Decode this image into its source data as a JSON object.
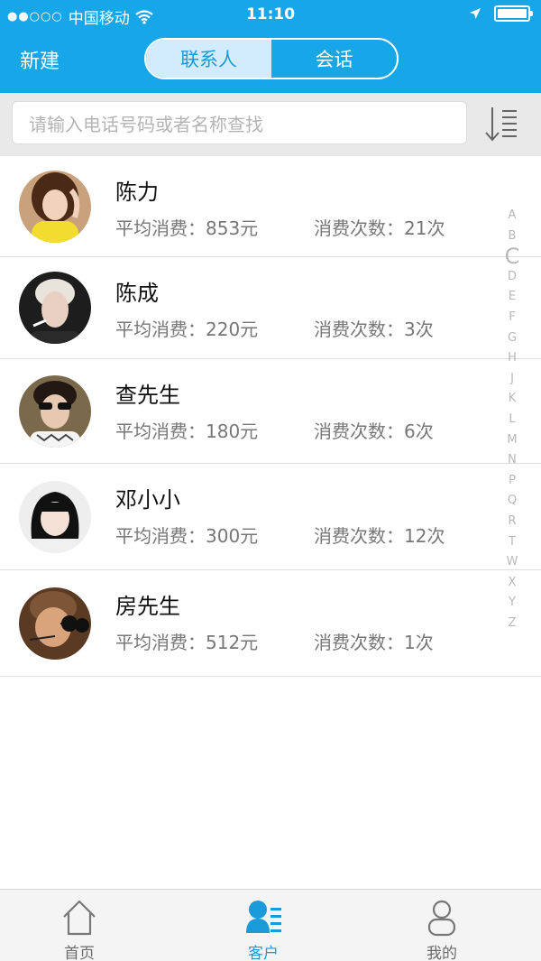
{
  "status_bar": {
    "signal": "●●○○○",
    "carrier": "中国移动",
    "time": "11:10"
  },
  "header": {
    "new_label": "新建",
    "tabs": [
      {
        "label": "联系人",
        "active": true
      },
      {
        "label": "会话",
        "active": false
      }
    ]
  },
  "search": {
    "placeholder": "请输入电话号码或者名称查找"
  },
  "contacts": [
    {
      "name": "陈力",
      "avg_spend": "平均消费：853元",
      "visit_count": "消费次数：21次"
    },
    {
      "name": "陈成",
      "avg_spend": "平均消费：220元",
      "visit_count": "消费次数：3次"
    },
    {
      "name": "查先生",
      "avg_spend": "平均消费：180元",
      "visit_count": "消费次数：6次"
    },
    {
      "name": "邓小小",
      "avg_spend": "平均消费：300元",
      "visit_count": "消费次数：12次"
    },
    {
      "name": "房先生",
      "avg_spend": "平均消费：512元",
      "visit_count": "消费次数：1次"
    }
  ],
  "index_letters": [
    "A",
    "B",
    "C",
    "D",
    "E",
    "F",
    "G",
    "H",
    "J",
    "K",
    "L",
    "M",
    "N",
    "P",
    "Q",
    "R",
    "T",
    "W",
    "X",
    "Y",
    "Z"
  ],
  "tabbar": [
    {
      "label": "首页",
      "icon": "home-icon",
      "active": false
    },
    {
      "label": "客户",
      "icon": "customers-icon",
      "active": true
    },
    {
      "label": "我的",
      "icon": "profile-icon",
      "active": false
    }
  ],
  "colors": {
    "accent": "#17a6e8",
    "active_tab": "#1a9ad8",
    "segment_active_bg": "#d2ecfb"
  }
}
